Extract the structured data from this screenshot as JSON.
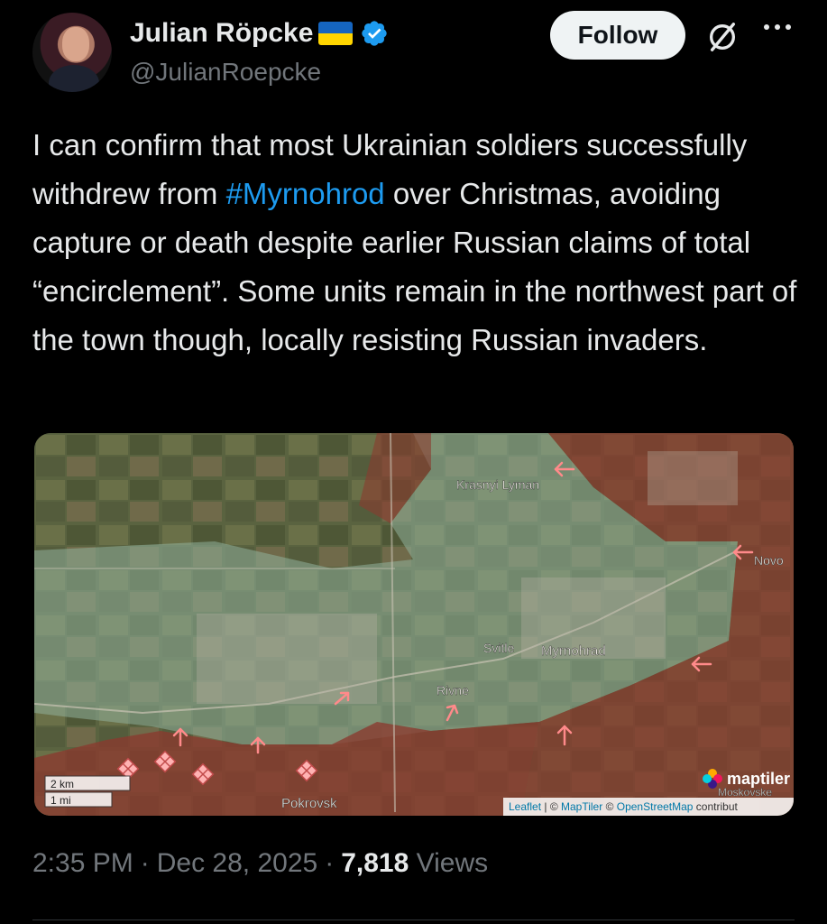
{
  "author": {
    "display_name": "Julian Röpcke",
    "handle": "@JulianRoepcke",
    "flag": "ukraine-flag",
    "verified": true
  },
  "actions": {
    "follow_label": "Follow",
    "grok_icon": "grok-icon",
    "more_icon": "more-icon"
  },
  "tweet": {
    "text_before": "I can confirm that most Ukrainian soldiers successfully withdrew from ",
    "hashtag": "#Myrnohrod",
    "text_after": " over Christmas, avoiding capture or death despite earlier Russian claims of total “encirclement”. Some units remain in the northwest part of the town though, locally resisting Russian invaders."
  },
  "map": {
    "labels": {
      "krasnyi_lyman": "Krasnyi Lyman",
      "novo": "Novo",
      "svitle": "Svitle",
      "myrnohrad": "Myrnohrad",
      "rivne": "Rivne",
      "pokrovsk": "Pokrovsk",
      "moskovske": "Moskovske"
    },
    "scale": {
      "km": "2 km",
      "mi": "1 mi"
    },
    "brand": "maptiler",
    "attribution": {
      "leaflet": "Leaflet",
      "sep": " | © ",
      "maptiler": "MapTiler",
      "osm_prefix": " © ",
      "osm": "OpenStreetMap",
      "suffix": " contribut"
    },
    "colors": {
      "russian_controlled": "#8a3a2e",
      "ukrainian_controlled": "#7fa08a",
      "arrow": "#ff8a8a"
    }
  },
  "meta": {
    "time": "2:35 PM",
    "dot1": "·",
    "date": "Dec 28, 2025",
    "dot2": "·",
    "views_count": "7,818",
    "views_label": "Views"
  }
}
